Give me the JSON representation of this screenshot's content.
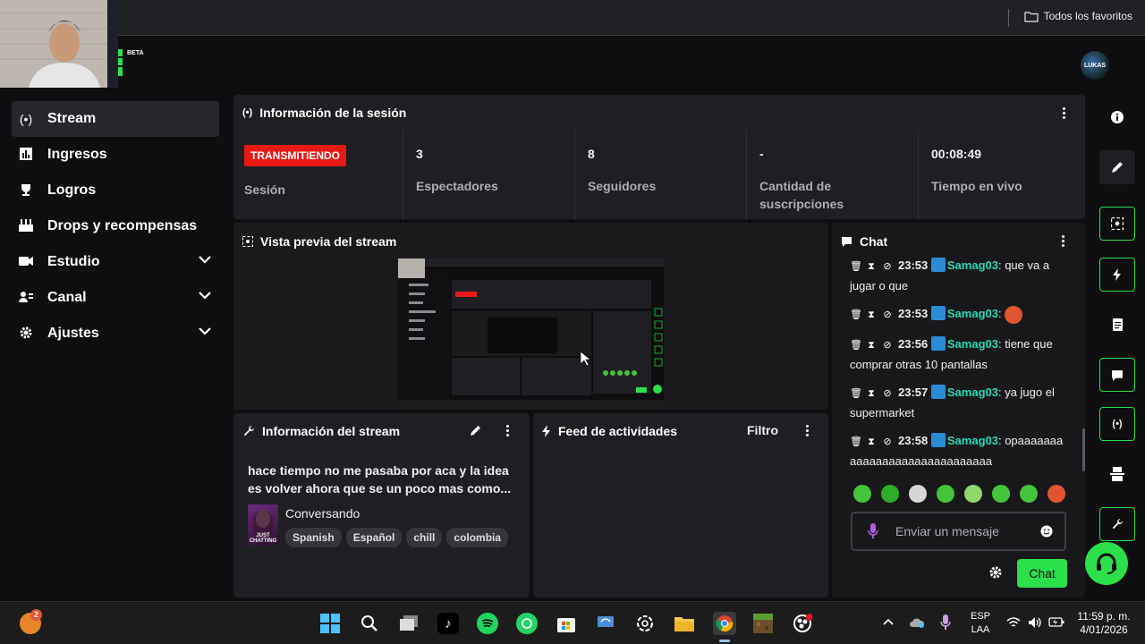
{
  "browser": {
    "favorites_label": "Todos los favoritos"
  },
  "brand": {
    "beta_label": "BETA",
    "avatar_text": "LUKAS"
  },
  "sidebar": {
    "items": [
      {
        "label": "Stream",
        "icon": "broadcast-icon",
        "active": true
      },
      {
        "label": "Ingresos",
        "icon": "bar-chart-icon"
      },
      {
        "label": "Logros",
        "icon": "trophy-icon"
      },
      {
        "label": "Drops y recompensas",
        "icon": "gift-icon"
      },
      {
        "label": "Estudio",
        "icon": "camera-icon",
        "expandable": true
      },
      {
        "label": "Canal",
        "icon": "users-icon",
        "expandable": true
      },
      {
        "label": "Ajustes",
        "icon": "gear-icon",
        "expandable": true
      }
    ]
  },
  "session": {
    "title": "Información de la sesión",
    "live_badge": "TRANSMITIENDO",
    "session_label": "Sesión",
    "stats": [
      {
        "value": "3",
        "label": "Espectadores"
      },
      {
        "value": "8",
        "label": "Seguidores"
      },
      {
        "value": "-",
        "label": "Cantidad de suscripciones"
      },
      {
        "value": "00:08:49",
        "label": "Tiempo en vivo"
      }
    ]
  },
  "preview": {
    "title": "Vista previa del stream"
  },
  "stream_info": {
    "title": "Información del stream",
    "description": "hace tiempo no me pasaba por aca y la idea es volver ahora que se un poco mas como...",
    "category": "Conversando",
    "category_art_text": "JUST CHATTING",
    "tags": [
      "Spanish",
      "Español",
      "chill",
      "colombia"
    ]
  },
  "activity": {
    "title": "Feed de actividades",
    "filter_label": "Filtro"
  },
  "chat": {
    "title": "Chat",
    "messages": [
      {
        "time": "23:53",
        "user": "Samag03",
        "text": ": que va a jugar o que"
      },
      {
        "time": "23:53",
        "user": "Samag03",
        "text": ":"
      },
      {
        "time": "23:56",
        "user": "Samag03",
        "text": ": tiene que comprar otras 10 pantallas"
      },
      {
        "time": "23:57",
        "user": "Samag03",
        "text": ": ya jugo el supermarket"
      },
      {
        "time": "23:58",
        "user": "Samag03",
        "text": ": opaaaaaaaaaaaaaaaaaaaaaaaaaaaaa"
      }
    ],
    "input_placeholder": "Enviar un mensaje",
    "send_label": "Chat"
  },
  "taskbar": {
    "notification_count": "2",
    "lang_top": "ESP",
    "lang_bottom": "LAA",
    "time": "11:59 p. m.",
    "date": "4/01/2026"
  },
  "colors": {
    "accent": "#2be04a",
    "live": "#e91916",
    "username": "#28d8b1",
    "panel": "#1f1f23"
  }
}
